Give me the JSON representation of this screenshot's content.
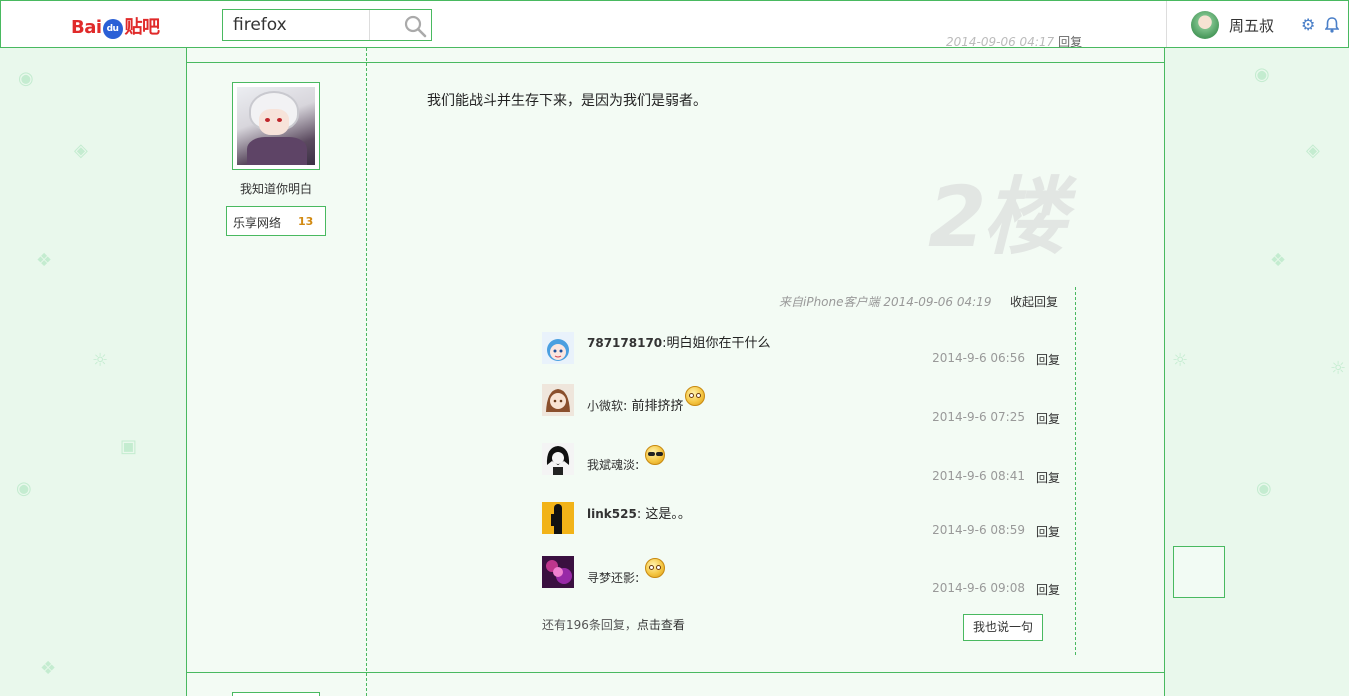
{
  "header": {
    "logo": {
      "bai": "Bai",
      "du": "du",
      "tieba": "贴吧"
    },
    "search": {
      "value": "firefox",
      "placeholder": ""
    },
    "user": {
      "name": "周五叔"
    }
  },
  "previous_post": {
    "time": "2014-09-06 04:17",
    "reply_label": "回复"
  },
  "post": {
    "author": {
      "name": "我知道你明白",
      "badge_label": "乐享网络",
      "badge_level": "13"
    },
    "content": "我们能战斗并生存下来，是因为我们是弱者。",
    "floor": "2楼",
    "meta": "来自iPhone客户端  2014-09-06 04:19",
    "collapse_label": "收起回复"
  },
  "comments": [
    {
      "user": "787178170",
      "text": "明白姐你在干什么",
      "emoji": "",
      "time": "2014-9-6 06:56",
      "reply_label": "回复"
    },
    {
      "user": "小微软",
      "text": "前排挤挤",
      "emoji": "smile-emoji",
      "time": "2014-9-6 07:25",
      "reply_label": "回复"
    },
    {
      "user": "我斌魂淡",
      "text": "",
      "emoji": "sunglasses-emoji",
      "time": "2014-9-6 08:41",
      "reply_label": "回复"
    },
    {
      "user": "link525",
      "text": "这是。。",
      "emoji": "",
      "time": "2014-9-6 08:59",
      "reply_label": "回复"
    },
    {
      "user": "寻梦还影",
      "text": "",
      "emoji": "smile-emoji",
      "time": "2014-9-6 09:08",
      "reply_label": "回复"
    }
  ],
  "more_replies": {
    "prefix": "还有196条回复，",
    "link": "点击查看"
  },
  "say_button": "我也说一句",
  "colors": {
    "accent_green": "#49b960",
    "background": "#e9f8ec",
    "logo_red": "#e02a2a",
    "logo_blue": "#2a5fd6"
  }
}
